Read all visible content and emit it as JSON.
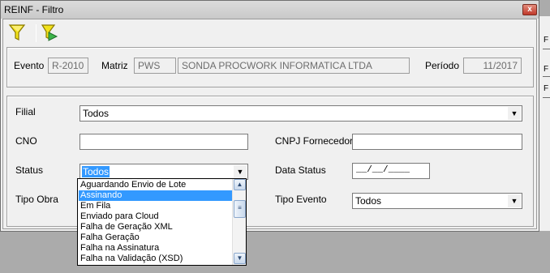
{
  "window": {
    "title": "REINF - Filtro",
    "close_symbol": "x"
  },
  "toolbar": {
    "icons": [
      "filter-icon",
      "clear-filter-icon"
    ]
  },
  "header": {
    "evento_label": "Evento",
    "evento_value": "R-2010",
    "matriz_label": "Matriz",
    "matriz_code": "PWS",
    "matriz_name": "SONDA PROCWORK INFORMATICA LTDA",
    "periodo_label": "Período",
    "periodo_value": "11/2017"
  },
  "filters": {
    "filial_label": "Filial",
    "filial_value": "Todos",
    "cno_label": "CNO",
    "cno_value": "",
    "cnpj_label": "CNPJ Fornecedor",
    "cnpj_value": "",
    "status_label": "Status",
    "status_value": "Todos",
    "data_status_label": "Data Status",
    "data_status_value": "__/__/____",
    "tipo_obra_label": "Tipo Obra",
    "tipo_evento_label": "Tipo Evento",
    "tipo_evento_value": "Todos"
  },
  "status_dropdown": {
    "items": [
      "Aguardando Envio de Lote",
      "Assinando",
      "Em Fila",
      "Enviado para Cloud",
      "Falha de Geração XML",
      "Falha Geração",
      "Falha na Assinatura",
      "Falha na Validação (XSD)"
    ],
    "highlighted_index": 1
  },
  "background_window": {
    "marks": [
      "F",
      "F",
      "F"
    ]
  },
  "colors": {
    "highlight": "#3399ff",
    "window_bg": "#f0f0f0",
    "desktop_bg": "#ababab"
  }
}
